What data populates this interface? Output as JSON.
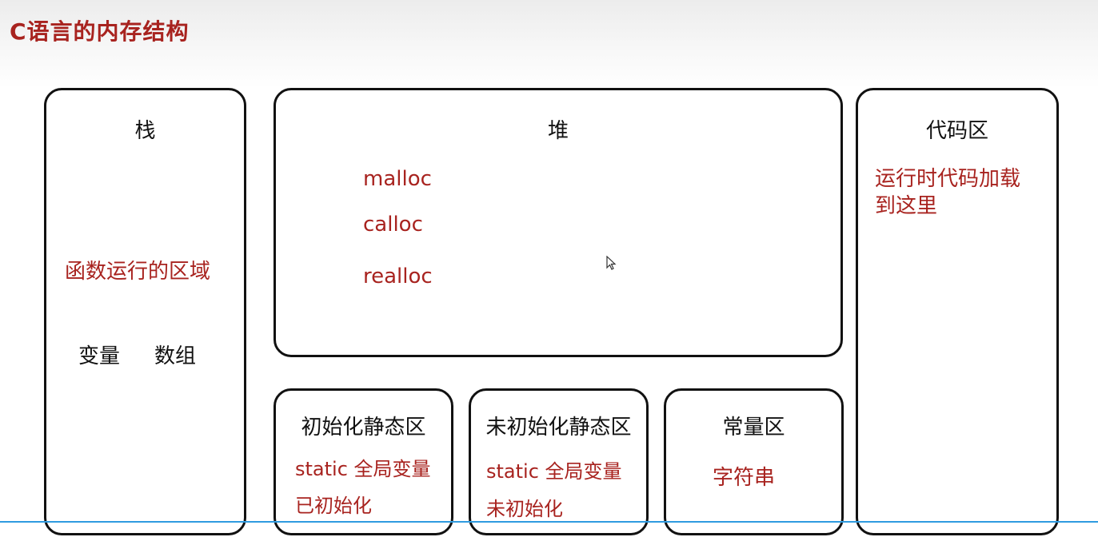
{
  "title": "C语言的内存结构",
  "stack": {
    "head": "栈",
    "desc": "函数运行的区域",
    "item1": "变量",
    "item2": "数组"
  },
  "heap": {
    "head": "堆",
    "funcs": [
      "malloc",
      "calloc",
      "realloc"
    ]
  },
  "code": {
    "head": "代码区",
    "desc_line1": "运行时代码加载",
    "desc_line2": "到这里"
  },
  "init_static": {
    "head": "初始化静态区",
    "line1": "static 全局变量",
    "line2": "已初始化"
  },
  "uninit_static": {
    "head": "未初始化静态区",
    "line1": "static 全局变量",
    "line2": "未初始化"
  },
  "const": {
    "head": "常量区",
    "desc": "字符串"
  }
}
